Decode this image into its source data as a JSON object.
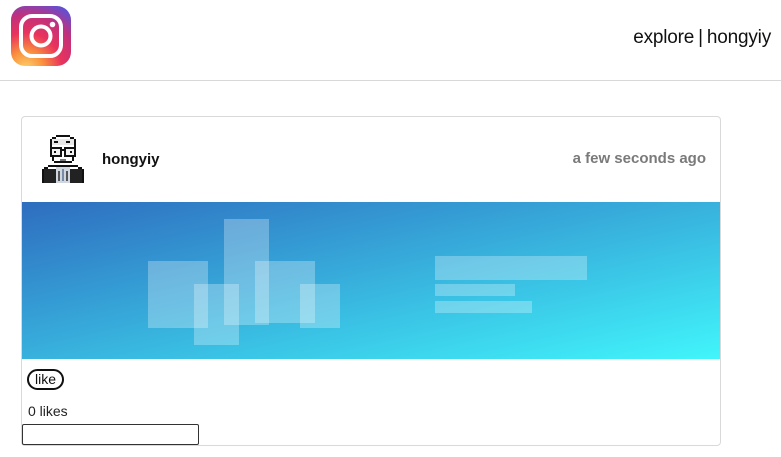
{
  "header": {
    "logo": "instagram-logo",
    "nav_explore": "explore",
    "nav_separator": "|",
    "nav_user": "hongyiy"
  },
  "post": {
    "username": "hongyiy",
    "timestamp": "a few seconds ago",
    "avatar": "pixel-avatar",
    "like_label": "like",
    "likes_text": "0 likes",
    "comment_placeholder": "",
    "image": {
      "gradient_start": "#2e6dbf",
      "gradient_end": "#41f5fb"
    }
  },
  "colors": {
    "border": "#d9d9d9",
    "timestamp": "#7a7a7a"
  }
}
